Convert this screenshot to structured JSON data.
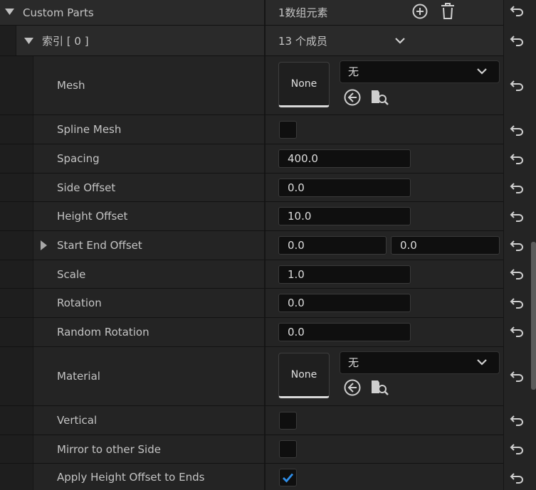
{
  "header": {
    "title": "Custom Parts",
    "count_text": "1数组元素"
  },
  "element": {
    "index_label": "索引 [ 0 ]",
    "members_text": "13 个成员"
  },
  "properties": {
    "mesh": {
      "label": "Mesh",
      "thumb": "None",
      "combo": "无"
    },
    "spline_mesh": {
      "label": "Spline Mesh",
      "checked": false
    },
    "spacing": {
      "label": "Spacing",
      "value": "400.0"
    },
    "side_offset": {
      "label": "Side Offset",
      "value": "0.0"
    },
    "height_offset": {
      "label": "Height Offset",
      "value": "10.0"
    },
    "start_end_offset": {
      "label": "Start End Offset",
      "value1": "0.0",
      "value2": "0.0"
    },
    "scale": {
      "label": "Scale",
      "value": "1.0"
    },
    "rotation": {
      "label": "Rotation",
      "value": "0.0"
    },
    "random_rotation": {
      "label": "Random Rotation",
      "value": "0.0"
    },
    "material": {
      "label": "Material",
      "thumb": "None",
      "combo": "无"
    },
    "vertical": {
      "label": "Vertical",
      "checked": false
    },
    "mirror": {
      "label": "Mirror to other Side",
      "checked": false
    },
    "apply_height": {
      "label": "Apply Height Offset to Ends",
      "checked": true
    }
  },
  "icons": {
    "reset": "reset-arrow-icon",
    "add": "plus-circle-icon",
    "delete": "trash-icon",
    "use_selected": "arrow-left-circle-icon",
    "browse": "folder-search-icon",
    "expand": "triangle-icon",
    "dropdown": "chevron-down-icon"
  },
  "colors": {
    "accent_check": "#2f8ee8"
  }
}
